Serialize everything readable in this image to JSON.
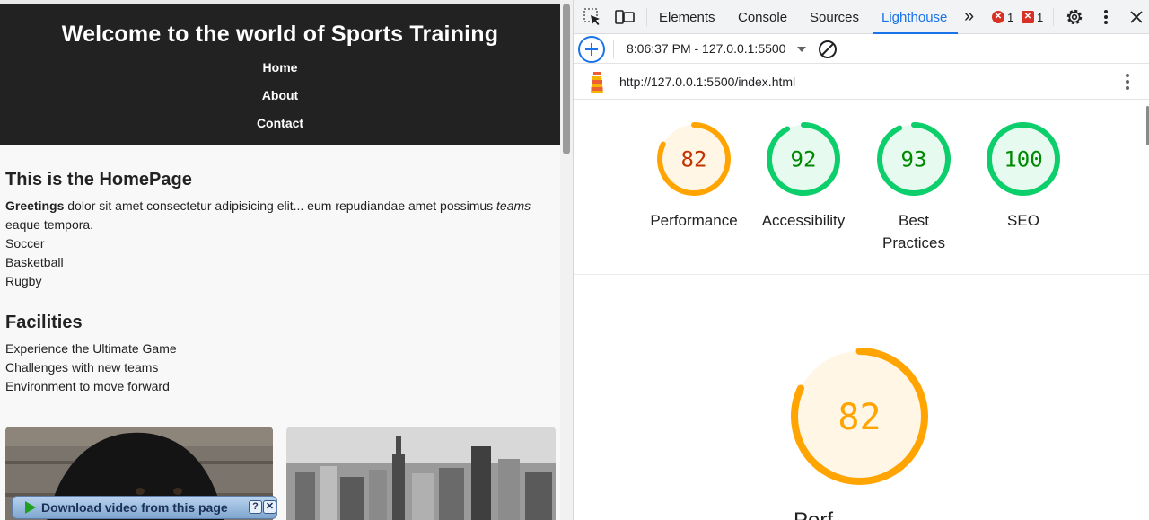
{
  "site": {
    "title": "Welcome to the world of Sports Training",
    "nav": [
      "Home",
      "About",
      "Contact"
    ],
    "home_heading": "This is the HomePage",
    "intro_bold": "Greetings",
    "intro_mid": " dolor sit amet consectetur adipisicing elit... eum repudiandae amet possimus ",
    "intro_italic": "teams",
    "intro_end": "eaque tempora.",
    "sports": [
      "Soccer",
      "Basketball",
      "Rugby"
    ],
    "facilities_heading": "Facilities",
    "facilities": [
      "Experience the Ultimate Game",
      "Challenges with new teams",
      "Environment to move forward"
    ],
    "download_bar": {
      "label": "Download video from this page",
      "help": "?",
      "close": "✕"
    }
  },
  "devtools": {
    "tabs": [
      "Elements",
      "Console",
      "Sources",
      "Lighthouse"
    ],
    "active_tab": "Lighthouse",
    "more_tabs": "»",
    "errors": {
      "error_count": "1",
      "issue_count": "1"
    },
    "report_label": "8:06:37 PM - 127.0.0.1:5500",
    "url": "http://127.0.0.1:5500/index.html",
    "colors": {
      "accent": "#1a73e8",
      "good": "#0cce6b",
      "average": "#ffa400",
      "good_text": "#008800",
      "average_text": "#c33300"
    },
    "scores": [
      {
        "label": "Performance",
        "value": 82,
        "display": "82",
        "rating": "average"
      },
      {
        "label": "Accessibility",
        "value": 92,
        "display": "92",
        "rating": "good"
      },
      {
        "label": "Best Practices",
        "value": 93,
        "display": "93",
        "rating": "good"
      },
      {
        "label": "SEO",
        "value": 100,
        "display": "100",
        "rating": "good"
      }
    ],
    "featured": {
      "value": 82,
      "display": "82",
      "label": "Performance"
    }
  }
}
